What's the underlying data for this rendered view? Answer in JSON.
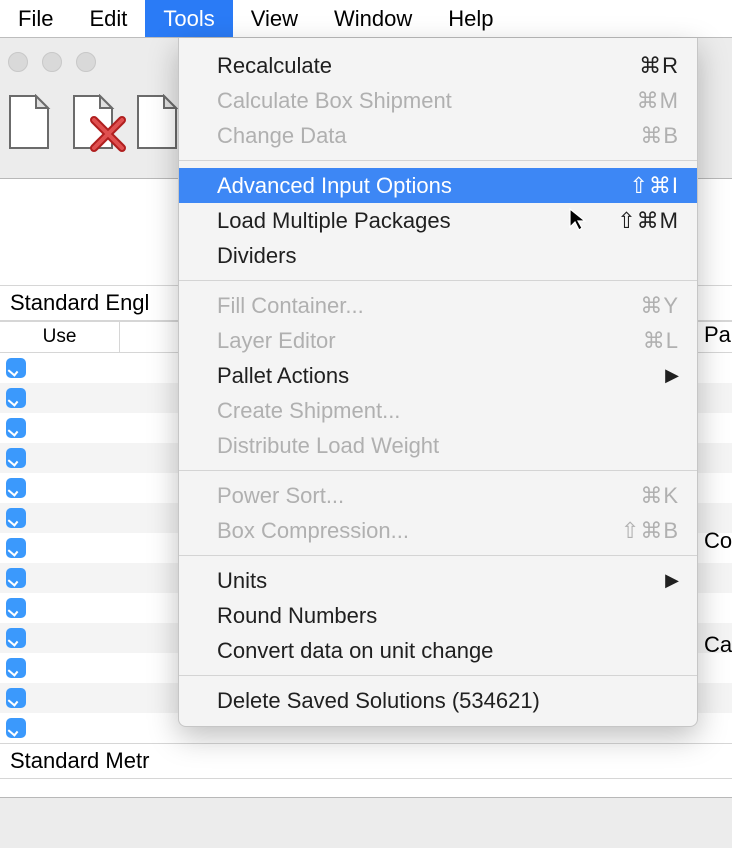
{
  "menubar": {
    "items": [
      "File",
      "Edit",
      "Tools",
      "View",
      "Window",
      "Help"
    ],
    "active_index": 2
  },
  "tools_menu": {
    "groups": [
      [
        {
          "label": "Recalculate",
          "shortcut": "⌘R",
          "enabled": true
        },
        {
          "label": "Calculate Box Shipment",
          "shortcut": "⌘M",
          "enabled": false
        },
        {
          "label": "Change Data",
          "shortcut": "⌘B",
          "enabled": false
        }
      ],
      [
        {
          "label": "Advanced Input Options",
          "shortcut": "⇧⌘I",
          "enabled": true,
          "highlighted": true
        },
        {
          "label": "Load Multiple Packages",
          "shortcut": "⇧⌘M",
          "enabled": true
        },
        {
          "label": "Dividers",
          "shortcut": "",
          "enabled": true
        }
      ],
      [
        {
          "label": "Fill Container...",
          "shortcut": "⌘Y",
          "enabled": false
        },
        {
          "label": "Layer Editor",
          "shortcut": "⌘L",
          "enabled": false
        },
        {
          "label": "Pallet Actions",
          "shortcut": "",
          "enabled": true,
          "submenu": true
        },
        {
          "label": "Create Shipment...",
          "shortcut": "",
          "enabled": false
        },
        {
          "label": "Distribute Load Weight",
          "shortcut": "",
          "enabled": false
        }
      ],
      [
        {
          "label": "Power Sort...",
          "shortcut": "⌘K",
          "enabled": false
        },
        {
          "label": "Box Compression...",
          "shortcut": "⇧⌘B",
          "enabled": false
        }
      ],
      [
        {
          "label": "Units",
          "shortcut": "",
          "enabled": true,
          "submenu": true
        },
        {
          "label": "Round Numbers",
          "shortcut": "",
          "enabled": true
        },
        {
          "label": "Convert data on unit change",
          "shortcut": "",
          "enabled": true
        }
      ],
      [
        {
          "label": "Delete Saved Solutions (534621)",
          "shortcut": "",
          "enabled": true
        }
      ]
    ]
  },
  "background": {
    "section1_label": "Standard Engl",
    "section2_label": "Standard Metr",
    "column_header": "Use",
    "row_count": 13,
    "right_labels": [
      "Pa",
      "Co",
      "Cas"
    ]
  }
}
